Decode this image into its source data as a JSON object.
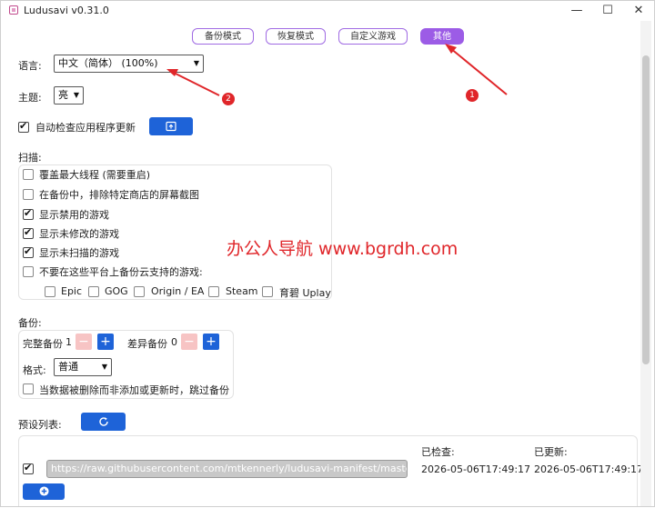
{
  "window": {
    "title": "Ludusavi v0.31.0",
    "controls": {
      "minimize": "—",
      "maximize": "☐",
      "close": "✕"
    }
  },
  "tabs": [
    {
      "label": "备份模式",
      "active": false
    },
    {
      "label": "恢复模式",
      "active": false
    },
    {
      "label": "自定义游戏",
      "active": false
    },
    {
      "label": "其他",
      "active": true
    }
  ],
  "language": {
    "label": "语言:",
    "value": "中文（简体） (100%)"
  },
  "theme": {
    "label": "主题:",
    "value": "亮"
  },
  "auto_update": {
    "label": "自动检查应用程序更新",
    "checked": true
  },
  "scan": {
    "label": "扫描:",
    "options": [
      {
        "label": "覆盖最大线程 (需要重启)",
        "checked": false
      },
      {
        "label": "在备份中，排除特定商店的屏幕截图",
        "checked": false
      },
      {
        "label": "显示禁用的游戏",
        "checked": true
      },
      {
        "label": "显示未修改的游戏",
        "checked": true
      },
      {
        "label": "显示未扫描的游戏",
        "checked": true
      },
      {
        "label": "不要在这些平台上备份云支持的游戏:",
        "checked": false
      }
    ],
    "platforms": [
      {
        "label": "Epic",
        "checked": false
      },
      {
        "label": "GOG",
        "checked": false
      },
      {
        "label": "Origin / EA",
        "checked": false
      },
      {
        "label": "Steam",
        "checked": false
      },
      {
        "label": "育碧 Uplay",
        "checked": false
      }
    ]
  },
  "backup": {
    "label": "备份:",
    "full_label": "完整备份",
    "full_value": "1",
    "diff_label": "差异备份",
    "diff_value": "0",
    "minus": "−",
    "plus": "+",
    "format_label": "格式:",
    "format_value": "普通",
    "skip_option": {
      "label": "当数据被删除而非添加或更新时，跳过备份",
      "checked": false
    }
  },
  "manifest": {
    "label": "预设列表:",
    "checked_header": "已检查:",
    "updated_header": "已更新:",
    "rows": [
      {
        "enabled": true,
        "url": "https://raw.githubusercontent.com/mtkennerly/ludusavi-manifest/master/data/manifest.yaml",
        "checked": "2026-05-06T17:49:17",
        "updated": "2026-05-06T17:49:17"
      }
    ]
  },
  "watermark": "办公人导航 www.bgrdh.com",
  "annotations": [
    "1",
    "2"
  ],
  "colors": {
    "accent": "#9c5ce6",
    "primary": "#1e63d8",
    "annotation": "#e0262a"
  }
}
